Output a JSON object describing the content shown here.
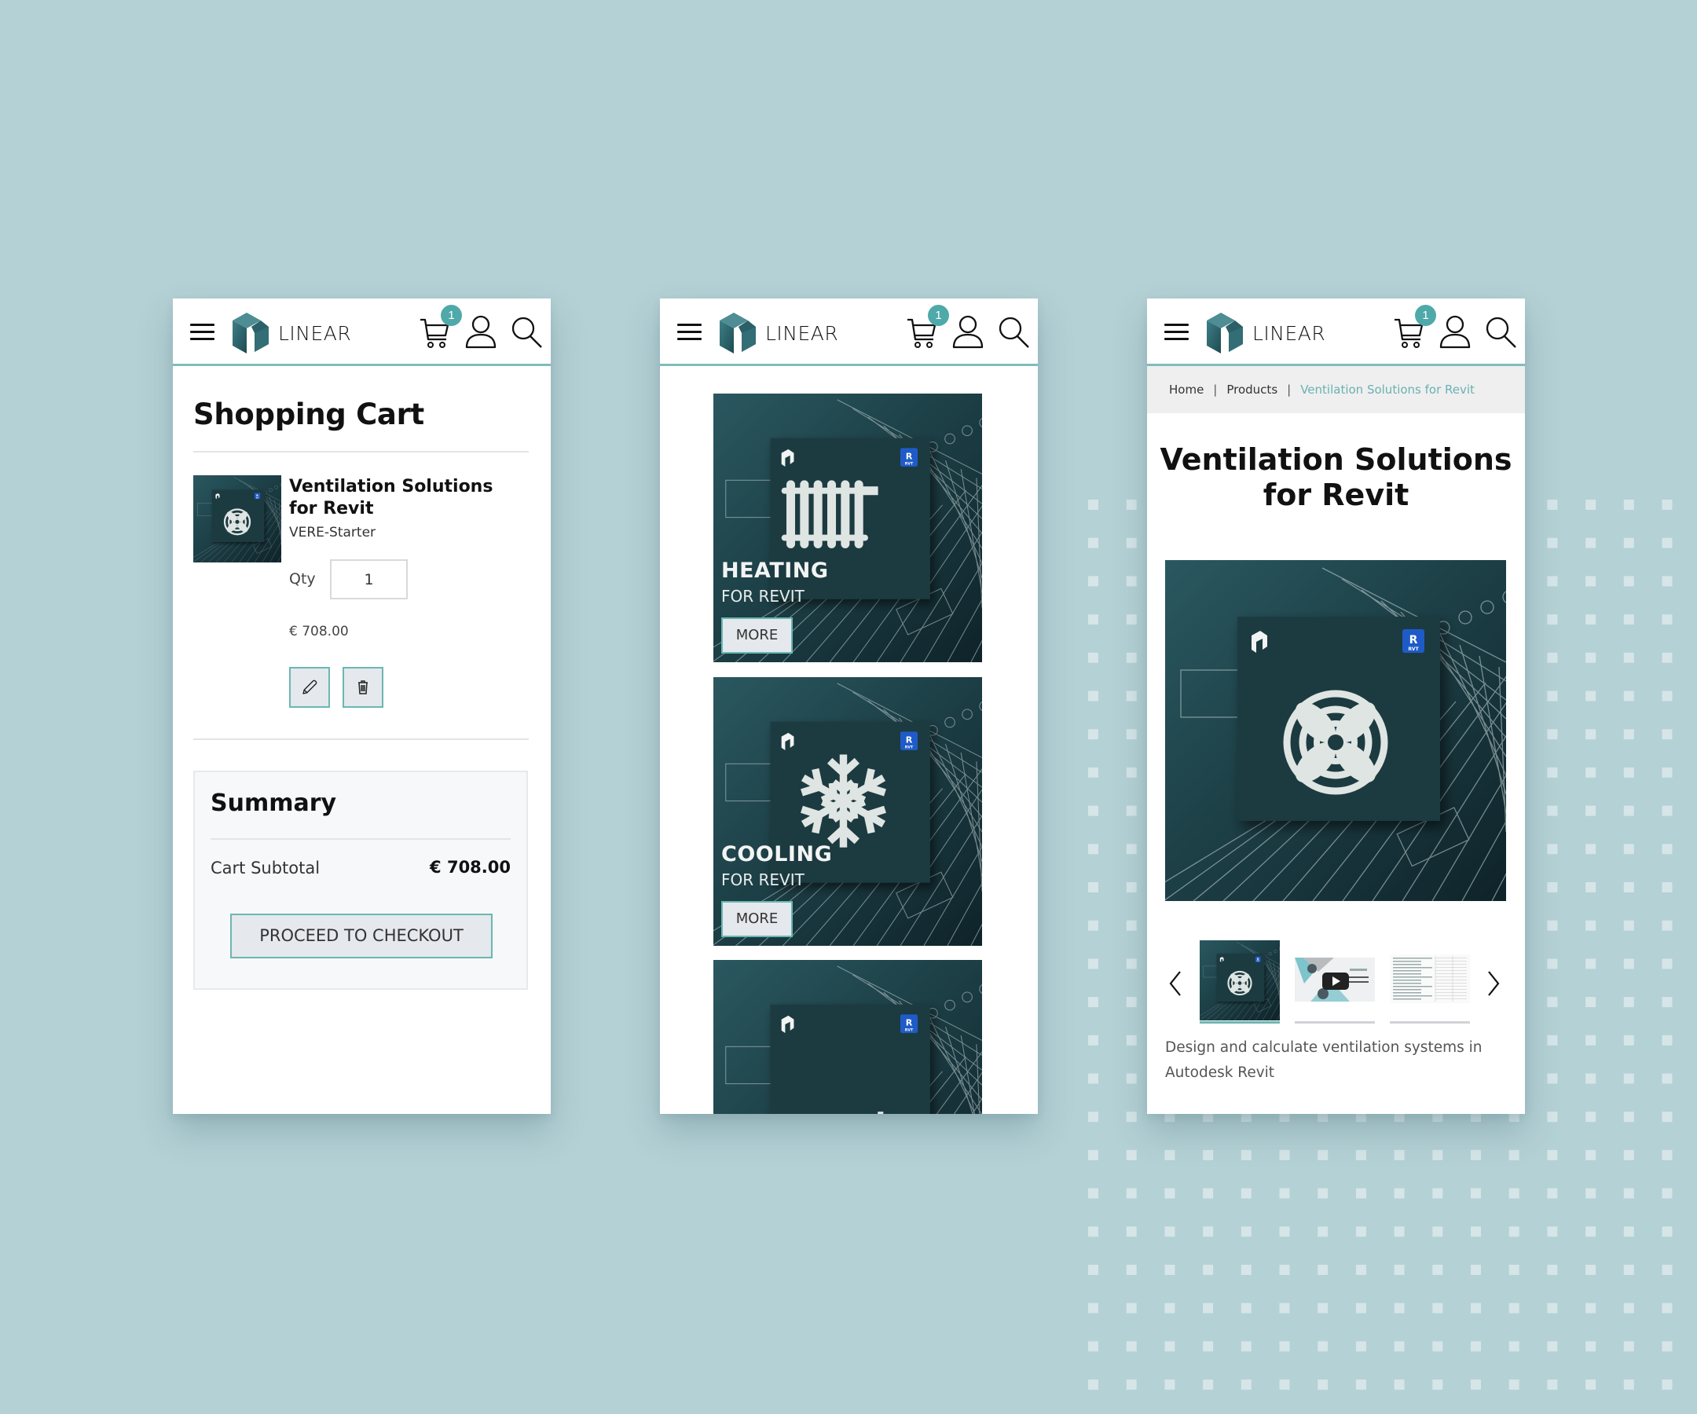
{
  "colors": {
    "background": "#b4d1d5",
    "accent": "#6ab7b3",
    "badge": "#4fa9a9",
    "tile_dark": "#1d3a41",
    "breadcrumb_current": "#6ab1b3"
  },
  "header": {
    "brand": "LINEAR",
    "cart_count": "1",
    "icons": [
      "menu-icon",
      "logo",
      "cart-icon",
      "user-icon",
      "search-icon"
    ]
  },
  "cart": {
    "title": "Shopping Cart",
    "item": {
      "name": "Ventilation Solutions for Revit",
      "sku": "VERE-Starter",
      "qty_label": "Qty",
      "qty_value": "1",
      "price": "€ 708.00",
      "edit_icon": "pencil-icon",
      "delete_icon": "trash-icon"
    },
    "summary": {
      "title": "Summary",
      "subtotal_label": "Cart Subtotal",
      "subtotal_value": "€ 708.00",
      "checkout_label": "PROCEED TO CHECKOUT"
    }
  },
  "product_list": {
    "tiles": [
      {
        "title": "HEATING",
        "subtitle": "FOR REVIT",
        "button": "MORE",
        "icon": "radiator-icon",
        "badge": "RVT"
      },
      {
        "title": "COOLING",
        "subtitle": "FOR REVIT",
        "button": "MORE",
        "icon": "snowflake-icon",
        "badge": "RVT"
      },
      {
        "title": "",
        "subtitle": "",
        "button": "",
        "icon": "radiator-snowflake-icon",
        "badge": "RVT"
      }
    ]
  },
  "product": {
    "breadcrumb": [
      "Home",
      "Products",
      "Ventilation Solutions for Revit"
    ],
    "breadcrumb_separator": "|",
    "title_line1": "Ventilation Solutions",
    "title_line2": "for Revit",
    "image_icon": "fan-icon",
    "image_badge": "RVT",
    "badge_letter": "R",
    "thumbnails": [
      {
        "kind": "image",
        "active": true
      },
      {
        "kind": "video",
        "active": false
      },
      {
        "kind": "table",
        "active": false
      }
    ],
    "description": "Design and calculate ventilation systems in Autodesk Revit"
  }
}
